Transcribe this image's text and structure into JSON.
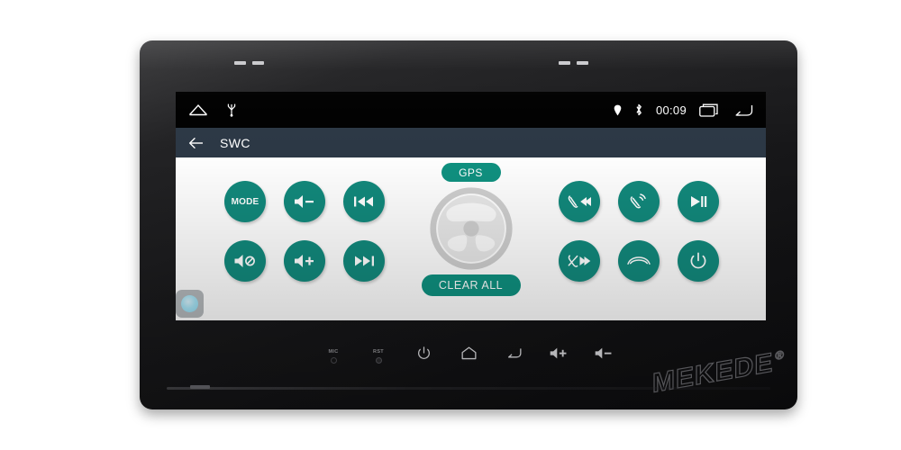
{
  "theme": {
    "accent_teal": "#12897c",
    "pill_teal": "#0f9180",
    "appbar_bg": "#2c3845",
    "statusbar_bg": "#000000",
    "screen_bg": "#ffffff",
    "dot_blue": "#8ed8f0"
  },
  "status_bar": {
    "home_icon": "home-icon",
    "usb_icon": "usb-icon",
    "location_icon": "location-pin-icon",
    "bluetooth_icon": "bluetooth-icon",
    "clock": "00:09",
    "recents_icon": "recent-apps-icon",
    "back_icon": "back-arrow-icon"
  },
  "app_bar": {
    "back_icon": "back-arrow-icon",
    "title": "SWC"
  },
  "left_buttons": [
    {
      "name": "mode-button",
      "label": "MODE",
      "icon": "text"
    },
    {
      "name": "volume-down-button",
      "label": "",
      "icon": "volume-down"
    },
    {
      "name": "previous-track-button",
      "label": "",
      "icon": "previous-track"
    },
    {
      "name": "mute-button",
      "label": "",
      "icon": "volume-mute"
    },
    {
      "name": "volume-up-button",
      "label": "",
      "icon": "volume-up"
    },
    {
      "name": "next-track-button",
      "label": "",
      "icon": "next-track"
    }
  ],
  "right_buttons": [
    {
      "name": "phone-previous-button",
      "label": "",
      "icon": "phone-previous"
    },
    {
      "name": "phone-answer-button",
      "label": "",
      "icon": "phone-answer"
    },
    {
      "name": "play-pause-button",
      "label": "",
      "icon": "play-pause"
    },
    {
      "name": "phone-reject-next-button",
      "label": "",
      "icon": "phone-reject-next"
    },
    {
      "name": "phone-hangup-button",
      "label": "",
      "icon": "phone-hangup"
    },
    {
      "name": "power-button",
      "label": "",
      "icon": "power"
    }
  ],
  "center": {
    "gps_label": "GPS",
    "clear_all_label": "CLEAR ALL",
    "wheel_icon": "steering-wheel-icon"
  },
  "floating": {
    "assist_dot": "assist-touch-dot"
  },
  "hard_keys": [
    {
      "name": "mic-hole",
      "label": "MIC",
      "icon": "hole"
    },
    {
      "name": "reset-hole",
      "label": "RST",
      "icon": "hole-rst"
    },
    {
      "name": "power-key",
      "label": "",
      "icon": "power"
    },
    {
      "name": "home-key",
      "label": "",
      "icon": "home"
    },
    {
      "name": "back-key",
      "label": "",
      "icon": "back"
    },
    {
      "name": "volume-up-key",
      "label": "",
      "icon": "vol-up"
    },
    {
      "name": "volume-down-key",
      "label": "",
      "icon": "vol-down"
    }
  ],
  "brand": {
    "name": "MEKEDE",
    "registered": "®"
  }
}
